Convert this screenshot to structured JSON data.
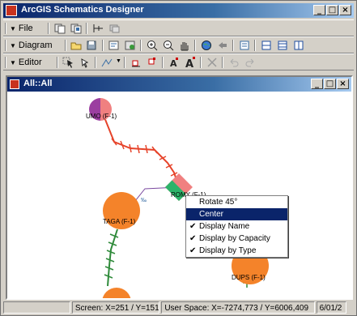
{
  "app": {
    "title": "ArcGIS Schematics Designer"
  },
  "menus": {
    "file": "File",
    "diagram": "Diagram",
    "editor": "Editor"
  },
  "child_window": {
    "title": "All::All"
  },
  "nodes": {
    "umo": "UMO (F-1)",
    "romy": "ROMY (F-1)",
    "taga": "TAGA (F-1)",
    "dups": "DUPS (F-1)"
  },
  "context_menu": {
    "items": [
      {
        "label": "Rotate 45°",
        "checked": false,
        "selected": false
      },
      {
        "label": "Center",
        "checked": false,
        "selected": true
      },
      {
        "label": "Display Name",
        "checked": true,
        "selected": false
      },
      {
        "label": "Display by Capacity",
        "checked": true,
        "selected": false
      },
      {
        "label": "Display by Type",
        "checked": true,
        "selected": false
      }
    ]
  },
  "status": {
    "screen": "Screen: X=251 / Y=151",
    "user_space": "User Space: X=-7274,773 / Y=6006,409",
    "date": "6/01/2"
  },
  "colors": {
    "title_active": "#0a246a",
    "node_orange": "#f4832a",
    "link_red": "#e6432a",
    "link_green": "#2f8a3a",
    "selected_node": "#2db36a",
    "umo_purple": "#9b3fa0",
    "umo_pink": "#f08080"
  }
}
